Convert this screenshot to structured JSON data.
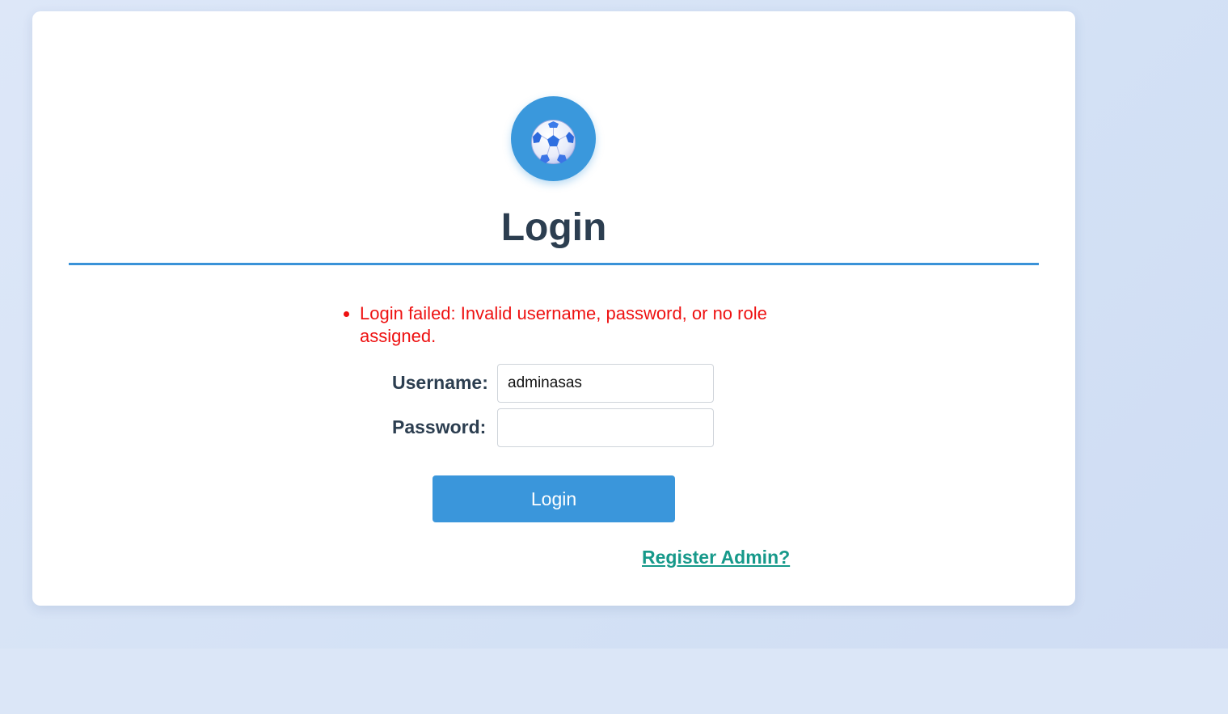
{
  "logo": {
    "icon": "soccer-ball-icon"
  },
  "page": {
    "title": "Login"
  },
  "errors": [
    "Login failed: Invalid username, password, or no role assigned."
  ],
  "form": {
    "username_label": "Username:",
    "username_value": "adminasas",
    "password_label": "Password:",
    "password_value": "",
    "submit_label": "Login"
  },
  "links": {
    "register": "Register Admin?"
  },
  "colors": {
    "accent": "#3a96db",
    "heading": "#2c3e50",
    "error": "#ee1111",
    "link": "#16998a"
  }
}
